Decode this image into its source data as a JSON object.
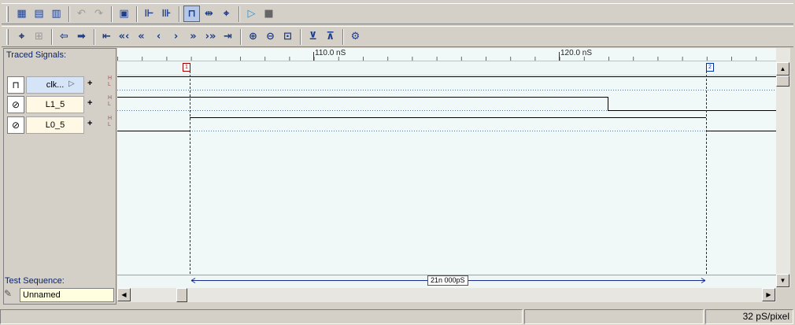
{
  "toolbar1": {
    "items": [
      {
        "name": "new-file-icon",
        "glyph": "▦"
      },
      {
        "name": "document-icon",
        "glyph": "▤"
      },
      {
        "name": "document-export-icon",
        "glyph": "▥"
      },
      {
        "name": "undo-icon",
        "glyph": "↶",
        "disabled": true
      },
      {
        "name": "redo-icon",
        "glyph": "↷",
        "disabled": true
      },
      {
        "name": "clipboard-icon",
        "glyph": "▣"
      },
      {
        "name": "insert-signal-icon",
        "glyph": "⊩"
      },
      {
        "name": "remove-signal-icon",
        "glyph": "⊪"
      },
      {
        "name": "clock-wave-icon",
        "glyph": "⊓",
        "pressed": true
      },
      {
        "name": "align-icon",
        "glyph": "⇹"
      },
      {
        "name": "probe-icon",
        "glyph": "⌖"
      },
      {
        "name": "run-icon",
        "glyph": "▷",
        "play": true
      },
      {
        "name": "stop-icon",
        "glyph": "■",
        "stop": true
      }
    ]
  },
  "toolbar2": {
    "items": [
      {
        "name": "select-signal-icon",
        "glyph": "⌖"
      },
      {
        "name": "grid-icon",
        "glyph": "⊞",
        "disabled": true
      },
      {
        "name": "arrow-left-icon",
        "glyph": "⇦"
      },
      {
        "name": "arrow-right-icon",
        "glyph": "➡"
      },
      {
        "name": "goto-start-icon",
        "glyph": "⇤"
      },
      {
        "name": "fast-back-icon",
        "glyph": "«‹"
      },
      {
        "name": "back-icon",
        "glyph": "«"
      },
      {
        "name": "step-back-icon",
        "glyph": "‹"
      },
      {
        "name": "step-forward-icon",
        "glyph": "›"
      },
      {
        "name": "forward-icon",
        "glyph": "»"
      },
      {
        "name": "fast-forward-icon",
        "glyph": "›»"
      },
      {
        "name": "goto-end-icon",
        "glyph": "⇥"
      },
      {
        "name": "zoom-in-icon",
        "glyph": "⊕"
      },
      {
        "name": "zoom-out-icon",
        "glyph": "⊖"
      },
      {
        "name": "zoom-fit-icon",
        "glyph": "⊡"
      },
      {
        "name": "expand-icon",
        "glyph": "⊻"
      },
      {
        "name": "collapse-icon",
        "glyph": "⊼"
      },
      {
        "name": "settings-icon",
        "glyph": "⚙"
      }
    ]
  },
  "left_panel": {
    "traced_signals_label": "Traced Signals:",
    "signals": [
      {
        "name": "clk...",
        "icon": "clock-wave-icon",
        "glyph": "⊓",
        "selected": true
      },
      {
        "name": "L1_5",
        "icon": "probe-signal-icon",
        "glyph": "⊘"
      },
      {
        "name": "L0_5",
        "icon": "probe-signal-icon",
        "glyph": "⊘"
      }
    ],
    "high_label": "H",
    "low_label": "L",
    "test_sequence_label": "Test Sequence:",
    "test_sequence_value": "Unnamed"
  },
  "ruler": {
    "labels": [
      "110.0 nS",
      "120.0 nS"
    ]
  },
  "markers": {
    "a": "1",
    "b": "2"
  },
  "measurement": "21n 000pS",
  "status": {
    "scale": "32 pS/pixel"
  },
  "colors": {
    "wave_bg": "#f0f8f8",
    "cursor_a": "#a00000",
    "cursor_b": "#0030a0",
    "trace": "#000000"
  }
}
